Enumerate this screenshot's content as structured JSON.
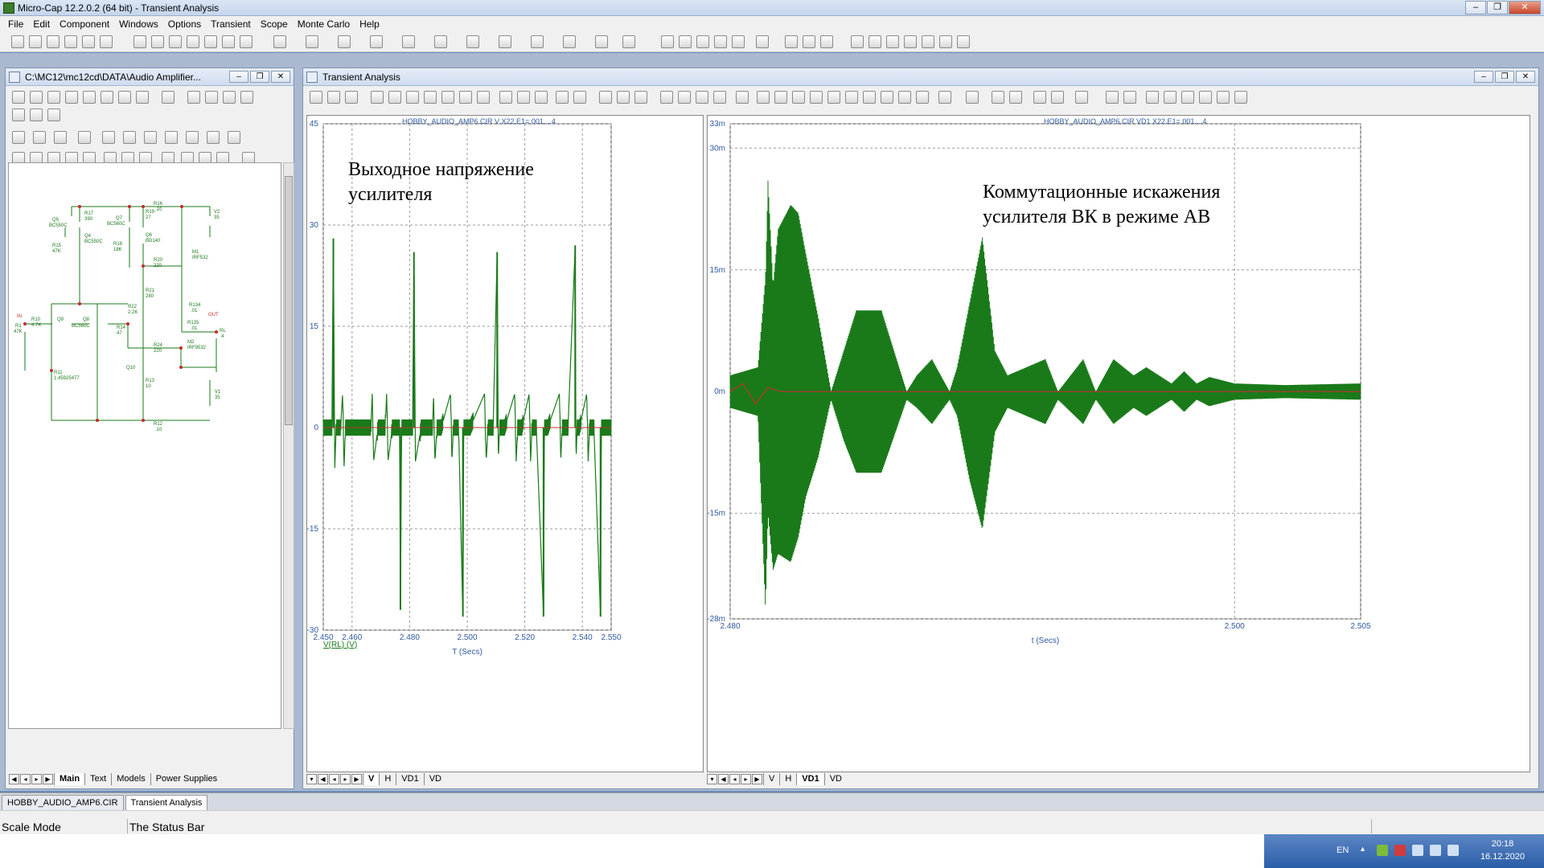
{
  "app": {
    "title": "Micro-Cap 12.2.0.2 (64 bit) - Transient Analysis",
    "window_buttons": [
      "–",
      "❐",
      "✕"
    ]
  },
  "menu": [
    "File",
    "Edit",
    "Component",
    "Windows",
    "Options",
    "Transient",
    "Scope",
    "Monte Carlo",
    "Help"
  ],
  "schematic_window": {
    "title": "C:\\MC12\\mc12cd\\DATA\\Audio Amplifier...",
    "tabs": [
      "Main",
      "Text",
      "Models",
      "Power Supplies"
    ],
    "active_tab": "Main",
    "labels": {
      "q5": "Q5",
      "q5m": "BC550C",
      "r17": "R17",
      "r17v": "390",
      "r15": "R15",
      "r15v": "47K",
      "q4": "Q4",
      "q4m": "BC550C",
      "q7": "Q7",
      "q7m": "BC560C",
      "r19": "R19",
      "r19v": "27",
      "r16": "R16",
      "r16v": ".10",
      "q6": "Q6",
      "q6m": "BD140",
      "r18": "R18",
      "r18v": "18K",
      "v2": "V2",
      "v2v": "35",
      "m1": "M1",
      "m1m": "IRF532",
      "r20": "R20",
      "r20v": "220",
      "r21": "R21",
      "r21v": "280",
      "r22": "R22",
      "r22v": "2.2K",
      "r134": "R134",
      "r134v": ".01",
      "out": "OUT",
      "in": "IN",
      "r10": "R10",
      "r10v": "4.7K",
      "r1": "R1",
      "r1v": "47K",
      "q9": "Q9",
      "q9m": "BC560C",
      "q8": "Q8",
      "r14": "R14",
      "r14v": "47",
      "r135": "R135",
      "r135v": ".01",
      "rl": "RL",
      "rlv": "4",
      "r24": "R24",
      "r24v": "220",
      "m2": "M2",
      "m2m": "IRF9532",
      "r11": "R11",
      "r11v": "1.45925477",
      "q10": "Q10",
      "r13": "R13",
      "r13v": "10",
      "v1": "V1",
      "v1v": "35",
      "r12": "R12",
      "r12v": ".10"
    }
  },
  "transient_window": {
    "title": "Transient Analysis",
    "tabs": [
      "V",
      "H",
      "VD1",
      "VD"
    ],
    "tabs_right": [
      "V",
      "H",
      "VD1",
      "VD"
    ],
    "active_left": "V",
    "active_right": "VD1"
  },
  "chart_data": [
    {
      "type": "line",
      "caption": "HOBBY_AUDIO_AMP6.CIR V X22.E1=.001....4",
      "annotation": "Выходное напряжение\nусилителя",
      "xlabel": "T (Secs)",
      "ylabel": "",
      "legend": "V(RL) (V)",
      "xlim": [
        2.45,
        2.55
      ],
      "ylim": [
        -30,
        45
      ],
      "x_ticks": [
        "2.450",
        "2.460",
        "2.480",
        "2.500",
        "2.520",
        "2.540",
        "2.550"
      ],
      "y_ticks": [
        "45",
        "30",
        "15",
        "0",
        "-15",
        "-30"
      ],
      "grid": true,
      "series": [
        {
          "color": "#1a7a1a",
          "x": [
            2.45,
            2.453,
            2.4535,
            2.454,
            2.4545,
            2.456,
            2.4567,
            2.4572,
            2.4577,
            2.459,
            2.462,
            2.4665,
            2.467,
            2.4675,
            2.469,
            2.4715,
            2.472,
            2.4725,
            2.474,
            2.4765,
            2.4768,
            2.4772,
            2.478,
            2.481,
            2.4815,
            2.482,
            2.484,
            2.488,
            2.4883,
            2.4888,
            2.4895,
            2.491,
            2.4942,
            2.4947,
            2.4952,
            2.497,
            2.4985,
            2.4988,
            2.4992,
            2.501,
            2.506,
            2.5066,
            2.5072,
            2.509,
            2.5104,
            2.5108,
            2.5112,
            2.513,
            2.5165,
            2.517,
            2.5175,
            2.519,
            2.5215,
            2.522,
            2.5225,
            2.524,
            2.5265,
            2.5268,
            2.5272,
            2.528,
            2.532,
            2.5325,
            2.533,
            2.535,
            2.5375,
            2.5378,
            2.5382,
            2.539,
            2.5415,
            2.542,
            2.5425,
            2.544,
            2.5463,
            2.5466,
            2.547,
            2.548,
            2.55
          ],
          "y": [
            0,
            0,
            28,
            -6,
            0,
            0,
            5,
            -6,
            0,
            0,
            0,
            0,
            5,
            -5,
            0,
            0,
            5,
            -5,
            0,
            0,
            -27,
            0,
            0,
            0,
            26,
            -5,
            0,
            0,
            5,
            -5,
            0,
            0,
            5,
            -5,
            0,
            0,
            -28,
            0,
            0,
            0,
            5,
            -5,
            0,
            0,
            26,
            -5,
            0,
            0,
            5,
            -5,
            0,
            0,
            5,
            -5,
            0,
            0,
            -28,
            0,
            0,
            0,
            5,
            -5,
            0,
            0,
            27,
            -5,
            0,
            0,
            5,
            -5,
            0,
            0,
            -28,
            0,
            0,
            0,
            0
          ]
        },
        {
          "color": "#c03030",
          "x": [
            2.45,
            2.55
          ],
          "y": [
            0,
            0
          ]
        }
      ]
    },
    {
      "type": "line",
      "caption": "HOBBY_AUDIO_AMP6.CIR VD1 X22.E1=.001....4",
      "annotation": "Коммутационные искажения\nусилителя ВК в режиме АВ",
      "xlabel": "t (Secs)",
      "ylabel": "",
      "xlim": [
        2.48,
        2.505
      ],
      "ylim": [
        -0.028,
        0.033
      ],
      "x_ticks": [
        "2.480",
        "2.500",
        "2.505"
      ],
      "y_ticks": [
        "33m",
        "30m",
        "15m",
        "0m",
        "-15m",
        "-28m"
      ],
      "grid": true,
      "series": [
        {
          "name": "envelope",
          "color": "#1a7a1a",
          "x": [
            2.48,
            2.4811,
            2.4814,
            2.4815,
            2.4817,
            2.4819,
            2.4824,
            2.4827,
            2.483,
            2.4835,
            2.484,
            2.4845,
            2.485,
            2.486,
            2.487,
            2.4874,
            2.488,
            2.4887,
            2.489,
            2.4895,
            2.49,
            2.4905,
            2.491,
            2.4925,
            2.493,
            2.494,
            2.4945,
            2.4952,
            2.496,
            2.4965,
            2.4975,
            2.498,
            2.4985,
            2.499,
            2.5,
            2.502,
            2.505
          ],
          "y_max": [
            0.002,
            0.003,
            0.014,
            0.026,
            0.013,
            0.02,
            0.023,
            0.022,
            0.017,
            0.009,
            0.0,
            0.005,
            0.01,
            0.01,
            0.0,
            0.002,
            0.004,
            0.0,
            0.003,
            0.011,
            0.019,
            0.005,
            0.002,
            0.004,
            0.0,
            0.004,
            0.0,
            0.004,
            0.002,
            0.003,
            0.001,
            0.0025,
            0.001,
            0.0018,
            0.001,
            0.0008,
            0.001
          ],
          "y_min": [
            -0.002,
            -0.003,
            -0.027,
            -0.015,
            -0.022,
            -0.02,
            -0.021,
            -0.018,
            -0.013,
            -0.008,
            -0.001,
            -0.006,
            -0.01,
            -0.01,
            -0.001,
            -0.002,
            -0.004,
            -0.001,
            -0.003,
            -0.011,
            -0.017,
            -0.005,
            -0.002,
            -0.004,
            -0.001,
            -0.004,
            -0.001,
            -0.004,
            -0.002,
            -0.003,
            -0.001,
            -0.0025,
            -0.001,
            -0.0018,
            -0.001,
            -0.0008,
            -0.001
          ]
        },
        {
          "name": "red",
          "color": "#c03030",
          "x": [
            2.48,
            2.4805,
            2.481,
            2.4815,
            2.482,
            2.505
          ],
          "y": [
            0,
            0.001,
            -0.0015,
            0.0005,
            0,
            0
          ]
        }
      ]
    }
  ],
  "doc_tabs": [
    "HOBBY_AUDIO_AMP6.CIR",
    "Transient Analysis"
  ],
  "doc_tab_active": "Transient Analysis",
  "status": {
    "mode": "Scale Mode",
    "text": "The Status Bar"
  },
  "taskbar": {
    "lang": "EN",
    "time": "20:18",
    "date": "16.12.2020"
  }
}
